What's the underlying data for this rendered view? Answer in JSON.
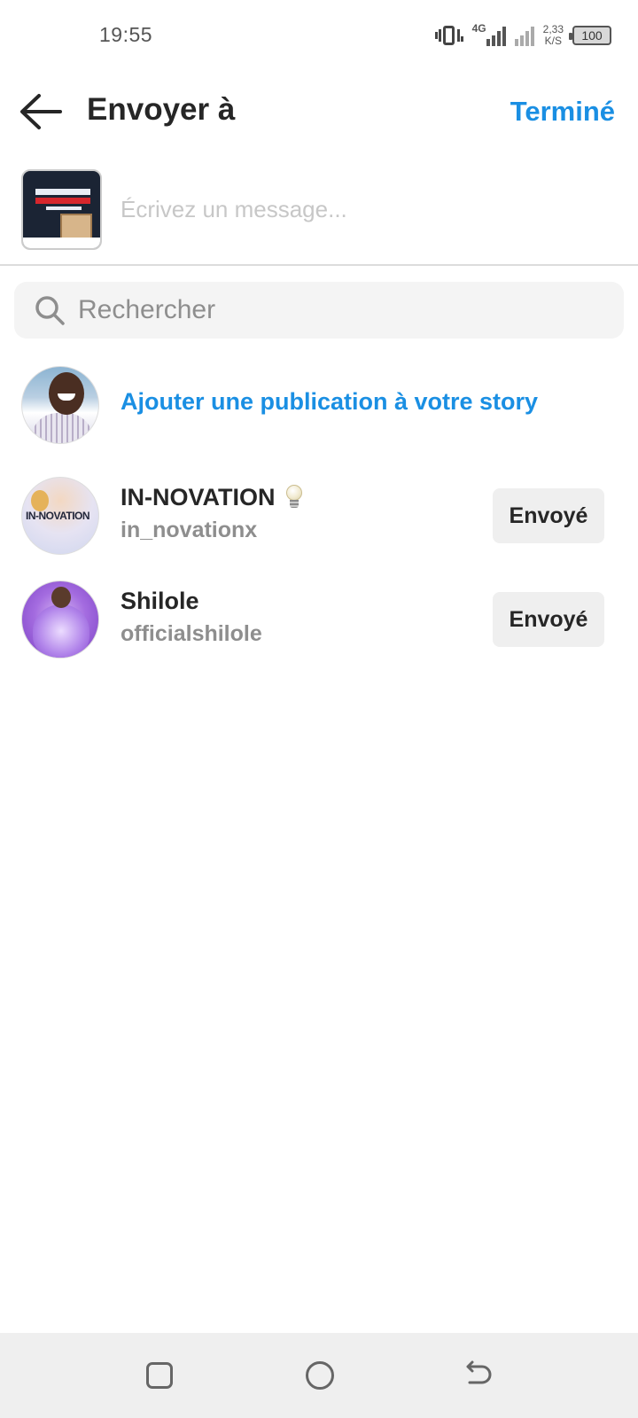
{
  "status_bar": {
    "time": "19:55",
    "network": "4G",
    "speed_line1": "2,33",
    "speed_line2": "K/S",
    "battery": "100"
  },
  "header": {
    "title": "Envoyer à",
    "done_label": "Terminé",
    "back_icon": "arrow-left-icon"
  },
  "message": {
    "placeholder": "Écrivez un message..."
  },
  "search": {
    "placeholder": "Rechercher",
    "icon": "search-icon"
  },
  "story": {
    "label": "Ajouter une publication à votre story"
  },
  "recipients": [
    {
      "name": "IN-NOVATION",
      "handle": "in_novationx",
      "status": "Envoyé",
      "emoji": "lightbulb-icon"
    },
    {
      "name": "Shilole",
      "handle": "officialshilole",
      "status": "Envoyé"
    }
  ],
  "colors": {
    "accent": "#1a8fe3",
    "text": "#262626",
    "muted": "#8e8e8e",
    "button_bg": "#efefef"
  }
}
